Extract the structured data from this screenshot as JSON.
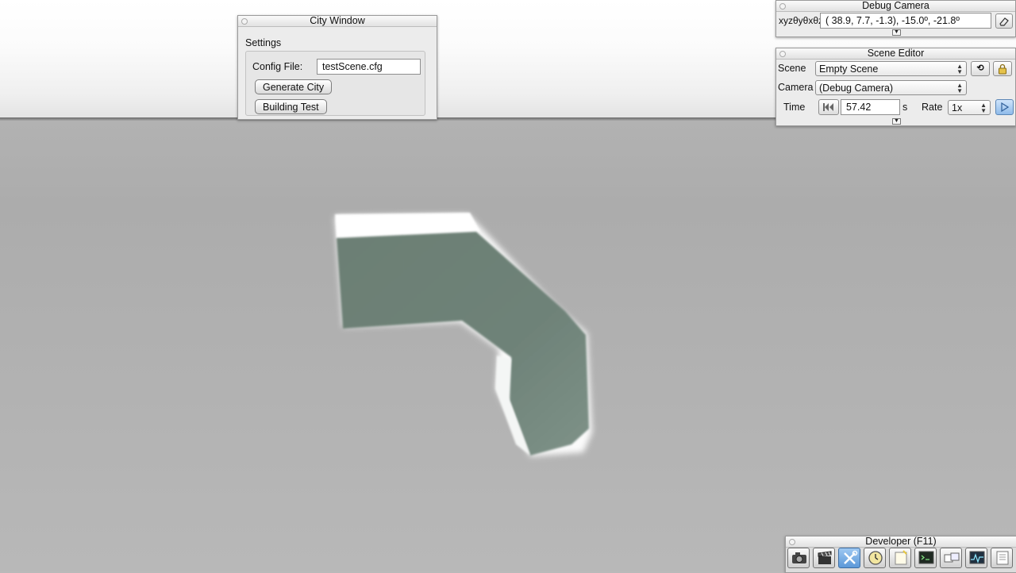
{
  "city_window": {
    "title": "City Window",
    "section": "Settings",
    "config_label": "Config File:",
    "config_value": "testScene.cfg",
    "generate_button": "Generate City",
    "building_button": "Building Test"
  },
  "debug_camera": {
    "title": "Debug Camera",
    "label": "xyzθyθxθz",
    "value": "( 38.9,   7.7,  -1.3), -15.0º, -21.8º"
  },
  "scene_editor": {
    "title": "Scene Editor",
    "scene_label": "Scene",
    "scene_value": "Empty Scene",
    "camera_label": "Camera",
    "camera_value": "(Debug Camera)",
    "time_label": "Time",
    "time_value": "57.42",
    "time_unit": "s",
    "rate_label": "Rate",
    "rate_value": "1x"
  },
  "developer": {
    "title": "Developer (F11)",
    "tools": [
      "camera-icon",
      "clapperboard-icon",
      "tools-icon",
      "clock-icon",
      "notepad-icon",
      "terminal-icon",
      "windows-icon",
      "monitor-icon",
      "document-icon"
    ],
    "active_tool": "tools-icon"
  },
  "colors": {
    "mesh": "#6f8379",
    "highlight": "#ffffff",
    "accent": "#5c98d8"
  }
}
